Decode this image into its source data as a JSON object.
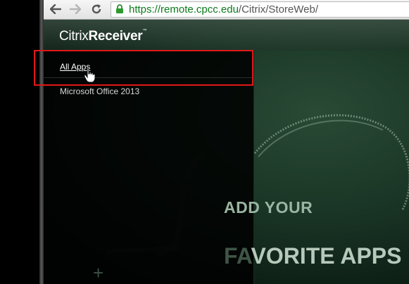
{
  "browser": {
    "url_scheme_host": "https://remote.cpcc.edu",
    "url_path": "/Citrix/StoreWeb/",
    "back_icon": "arrow-left-icon",
    "forward_icon": "arrow-right-icon",
    "reload_icon": "reload-icon",
    "lock_icon": "lock-icon"
  },
  "app": {
    "brand_light": "Citrix",
    "brand_bold": "Receiver",
    "brand_tm": "™"
  },
  "sidebar": {
    "items": [
      {
        "label": "All Apps"
      },
      {
        "label": "Microsoft Office 2013"
      }
    ]
  },
  "promo": {
    "line1": "ADD YOUR",
    "line2_dim": "FA",
    "line2_rest": "VORITE APPS",
    "plus": "+"
  },
  "colors": {
    "highlight": "#e01818",
    "url_green": "#0b7a1a"
  }
}
